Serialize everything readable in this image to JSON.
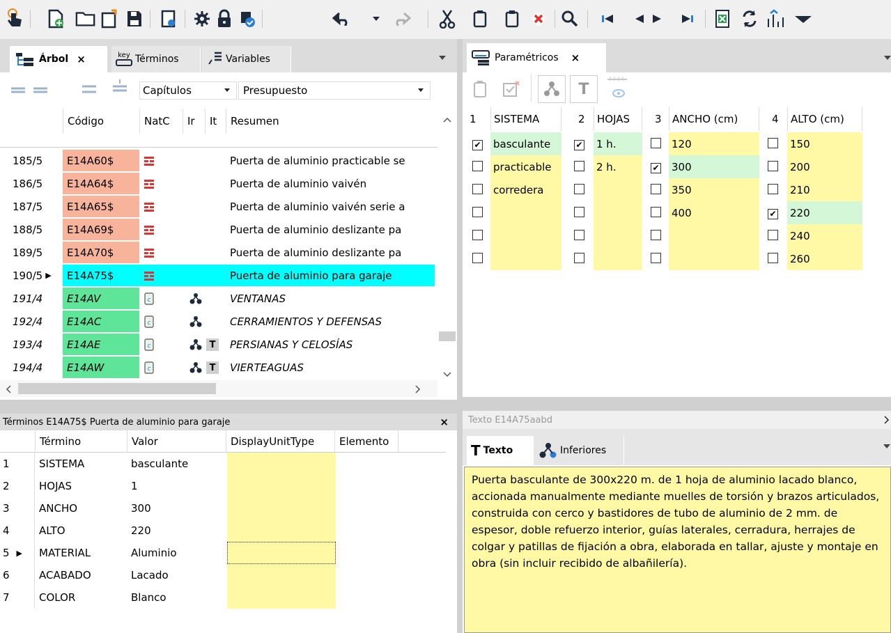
{
  "toolbar": {
    "icons": [
      "cursor-hand-icon",
      "new-document-icon",
      "open-folder-icon",
      "new-window-icon",
      "save-icon",
      "page-view-icon",
      "settings-gear-icon",
      "lock-icon",
      "check-settings-icon",
      "undo-icon",
      "dropdown-arrow-icon",
      "redo-icon",
      "cut-icon",
      "copy-icon",
      "paste-icon",
      "delete-icon",
      "search-icon",
      "first-record-icon",
      "previous-record-icon",
      "next-record-icon",
      "last-record-icon",
      "excel-icon",
      "refresh-icon",
      "chart-icon",
      "more-icon"
    ]
  },
  "left_panel": {
    "tabs": [
      {
        "label": "Árbol",
        "icon": "tree-icon",
        "active": true,
        "close": "×"
      },
      {
        "label": "Términos",
        "icon": "key-icon",
        "key_text": "key"
      },
      {
        "label": "Variables",
        "icon": "variables-icon"
      }
    ],
    "filter_select": "Capítulos",
    "view_select": "Presupuesto",
    "columns": [
      "Código",
      "NatC",
      "Ir",
      "It",
      "Resumen"
    ],
    "rows": [
      {
        "num": "185/5",
        "code": "E14A60$",
        "resumen": "Puerta de aluminio practicable se",
        "italic": false,
        "type": "partida",
        "ir": "",
        "it": ""
      },
      {
        "num": "186/5",
        "code": "E14A64$",
        "resumen": "Puerta de aluminio vaivén",
        "italic": false,
        "type": "partida",
        "ir": "",
        "it": ""
      },
      {
        "num": "187/5",
        "code": "E14A65$",
        "resumen": "Puerta de aluminio vaivén serie a",
        "italic": false,
        "type": "partida",
        "ir": "",
        "it": ""
      },
      {
        "num": "188/5",
        "code": "E14A69$",
        "resumen": "Puerta de aluminio deslizante pa",
        "italic": false,
        "type": "partida",
        "ir": "",
        "it": ""
      },
      {
        "num": "189/5",
        "code": "E14A70$",
        "resumen": "Puerta de aluminio deslizante pa",
        "italic": false,
        "type": "partida",
        "ir": "",
        "it": ""
      },
      {
        "num": "190/5",
        "code": "E14A75$",
        "resumen": "Puerta de aluminio para garaje",
        "italic": false,
        "type": "partida",
        "selected": true,
        "ir": "",
        "it": ""
      },
      {
        "num": "191/4",
        "code": "E14AV",
        "resumen": "VENTANAS",
        "italic": true,
        "type": "capitulo",
        "ir": "tree",
        "it": ""
      },
      {
        "num": "192/4",
        "code": "E14AC",
        "resumen": "CERRAMIENTOS Y DEFENSAS",
        "italic": true,
        "type": "capitulo",
        "ir": "tree",
        "it": ""
      },
      {
        "num": "193/4",
        "code": "E14AE",
        "resumen": "PERSIANAS Y CELOSÍAS",
        "italic": true,
        "type": "capitulo",
        "ir": "tree",
        "it": "T"
      },
      {
        "num": "194/4",
        "code": "E14AW",
        "resumen": "VIERTEAGUAS",
        "italic": true,
        "type": "capitulo",
        "ir": "tree",
        "it": "T"
      }
    ]
  },
  "terms_panel": {
    "title": "Términos E14A75$ Puerta de aluminio para garaje",
    "close": "×",
    "columns": [
      "Término",
      "Valor",
      "DisplayUnitType",
      "Elemento"
    ],
    "rows": [
      {
        "n": "1",
        "term": "SISTEMA",
        "value": "basculante"
      },
      {
        "n": "2",
        "term": "HOJAS",
        "value": "1"
      },
      {
        "n": "3",
        "term": "ANCHO",
        "value": "300"
      },
      {
        "n": "4",
        "term": "ALTO",
        "value": "220"
      },
      {
        "n": "5",
        "term": "MATERIAL",
        "value": "Aluminio",
        "current": true
      },
      {
        "n": "6",
        "term": "ACABADO",
        "value": "Lacado"
      },
      {
        "n": "7",
        "term": "COLOR",
        "value": "Blanco"
      }
    ]
  },
  "param_panel": {
    "tab": {
      "label": "Paramétricos",
      "close": "×"
    },
    "toolbar_icons": [
      "copy-icon",
      "check-remove-icon",
      "tree-icon",
      "text-t-icon",
      "ruler-eye-icon"
    ],
    "toolbar_t": "T",
    "groups": [
      {
        "num": "1",
        "name": "SISTEMA",
        "options": [
          {
            "label": "basculante",
            "checked": true
          },
          {
            "label": "practicable",
            "checked": false
          },
          {
            "label": "corredera",
            "checked": false
          },
          {
            "label": "",
            "checked": false
          },
          {
            "label": "",
            "checked": false
          },
          {
            "label": "",
            "checked": false
          }
        ]
      },
      {
        "num": "2",
        "name": "HOJAS",
        "options": [
          {
            "label": "1 h.",
            "checked": true
          },
          {
            "label": "2 h.",
            "checked": false
          },
          {
            "label": "",
            "checked": false
          },
          {
            "label": "",
            "checked": false
          },
          {
            "label": "",
            "checked": false
          },
          {
            "label": "",
            "checked": false
          }
        ]
      },
      {
        "num": "3",
        "name": "ANCHO (cm)",
        "options": [
          {
            "label": "120",
            "checked": false
          },
          {
            "label": "300",
            "checked": true
          },
          {
            "label": "350",
            "checked": false
          },
          {
            "label": "400",
            "checked": false
          },
          {
            "label": "",
            "checked": false
          },
          {
            "label": "",
            "checked": false
          }
        ]
      },
      {
        "num": "4",
        "name": "ALTO (cm)",
        "options": [
          {
            "label": "150",
            "checked": false
          },
          {
            "label": "200",
            "checked": false
          },
          {
            "label": "210",
            "checked": false
          },
          {
            "label": "220",
            "checked": true
          },
          {
            "label": "240",
            "checked": false
          },
          {
            "label": "260",
            "checked": false
          }
        ]
      }
    ]
  },
  "text_panel": {
    "title": "Texto E14A75aabd",
    "tabs": [
      {
        "label": "Texto",
        "icon": "text-t-icon",
        "active": true
      },
      {
        "label": "Inferiores",
        "icon": "tree-icon",
        "active": false
      }
    ],
    "body": "Puerta basculante de 300x220 m. de 1 hoja de aluminio lacado blanco, accionada manualmente mediante muelles de torsión y brazos articulados, construida con cerco y bastidores de tubo de aluminio de 2 mm. de espesor, doble refuerzo interior, guías laterales, cerradura, herrajes de colgar y patillas de fijación a obra, elaborada en tallar, ajuste y montaje en obra (sin incluir recibido de albañilería)."
  },
  "colors": {
    "partida_code": "#f7b49a",
    "capitulo_code": "#5ee59a",
    "selected": "#00ffff",
    "param_yellow": "#fff9a6",
    "param_green": "#d4f7d8",
    "icon_red": "#e0332f"
  }
}
